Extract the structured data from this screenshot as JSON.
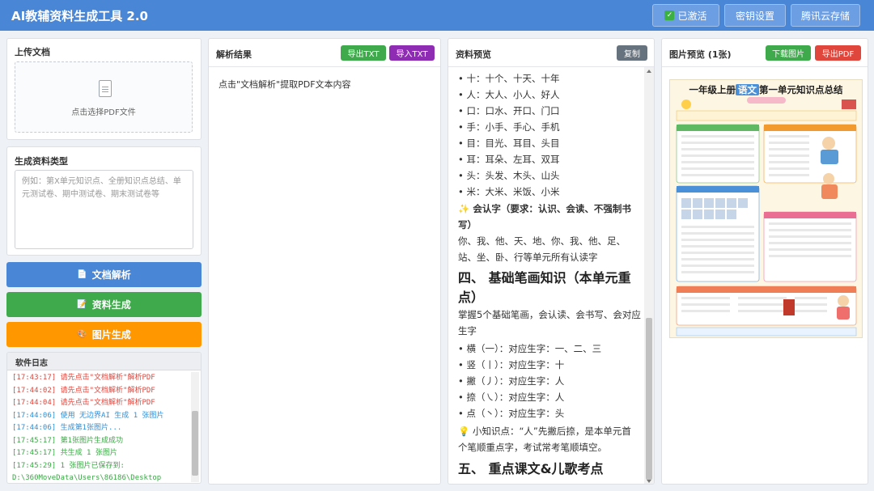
{
  "app": {
    "title": "AI教辅资料生成工具 2.0",
    "buttons": {
      "activated": "已激活",
      "key_settings": "密钥设置",
      "tencent_cloud": "腾讯云存储"
    }
  },
  "left": {
    "upload_title": "上传文档",
    "upload_hint": "点击选择PDF文件",
    "type_title": "生成资料类型",
    "type_placeholder": "例如：第X单元知识点、全册知识点总结、单元测试卷、期中测试卷、期末测试卷等",
    "btn_parse": "文档解析",
    "btn_generate": "资料生成",
    "btn_image": "图片生成",
    "log_title": "软件日志",
    "log": [
      {
        "text": "[17:43:17] 请先点击\"文档解析\"解析PDF",
        "color": "#e0463c"
      },
      {
        "text": "[17:44:02] 请先点击\"文档解析\"解析PDF",
        "color": "#e0463c"
      },
      {
        "text": "[17:44:04] 请先点击\"文档解析\"解析PDF",
        "color": "#e0463c"
      },
      {
        "text": "[17:44:06] 使用 无边界AI 生成 1 张图片",
        "color": "#2f8fd8"
      },
      {
        "text": "[17:44:06] 生成第1张图片...",
        "color": "#2f8fd8"
      },
      {
        "text": "[17:45:17] 第1张图片生成成功",
        "color": "#3aa845"
      },
      {
        "text": "[17:45:17] 共生成 1 张图片",
        "color": "#3aa845"
      },
      {
        "text": "[17:45:29] 1 张图片已保存到: D:\\360MoveData\\Users\\86186\\Desktop",
        "color": "#3aa845"
      }
    ]
  },
  "parse": {
    "title": "解析结果",
    "export_txt": "导出TXT",
    "import_txt": "导入TXT",
    "hint": "点击\"文档解析\"提取PDF文本内容"
  },
  "preview": {
    "title": "资料预览",
    "copy": "复制",
    "lines": [
      {
        "text": "• 十：十个、十天、十年",
        "style": ""
      },
      {
        "text": "• 人：大人、小人、好人",
        "style": ""
      },
      {
        "text": "• 口：口水、开口、门口",
        "style": ""
      },
      {
        "text": "• 手：小手、手心、手机",
        "style": ""
      },
      {
        "text": "• 目：目光、耳目、头目",
        "style": ""
      },
      {
        "text": "• 耳：耳朵、左耳、双耳",
        "style": ""
      },
      {
        "text": "• 头：头发、木头、山头",
        "style": ""
      },
      {
        "text": "• 米：大米、米饭、小米",
        "style": ""
      },
      {
        "text": "✨ 会认字（要求：认识、会读、不强制书",
        "style": "b"
      },
      {
        "text": "写）",
        "style": "b"
      },
      {
        "text": "你、我、他、天、地、你、我、他、足、",
        "style": ""
      },
      {
        "text": "站、坐、卧、行等单元所有认读字",
        "style": ""
      },
      {
        "text": "四、 基础笔画知识（本单元重",
        "style": "h"
      },
      {
        "text": "点）",
        "style": "h"
      },
      {
        "text": "掌握5个基础笔画，会认读、会书写、会对应",
        "style": ""
      },
      {
        "text": "生字",
        "style": ""
      },
      {
        "text": "• 横（一）：对应生字：一、二、三",
        "style": ""
      },
      {
        "text": "• 竖（丨）：对应生字：十",
        "style": ""
      },
      {
        "text": "• 撇（丿）：对应生字：人",
        "style": ""
      },
      {
        "text": "• 捺（㇏）：对应生字：人",
        "style": ""
      },
      {
        "text": "• 点（丶）：对应生字：头",
        "style": ""
      },
      {
        "text": "💡 小知识点：“人”先撇后捺，是本单元首",
        "style": ""
      },
      {
        "text": "个笔顺重点字，考试常考笔顺填空。",
        "style": ""
      },
      {
        "text": "五、 重点课文&儿歌考点",
        "style": "h"
      }
    ]
  },
  "image_preview": {
    "title": "图片预览 (1张)",
    "download": "下载图片",
    "export_pdf": "导出PDF",
    "poster_title_a": "一年级上册",
    "poster_title_b": "语文",
    "poster_title_c": "第一单元知识点总结"
  },
  "colors": {
    "titlebar": "#4a86d6",
    "blue_button": "#4a86d6",
    "green_button": "#3faa4b",
    "orange_button": "#ff9800",
    "purple_button": "#8e2cb4",
    "red_button": "#e0463c",
    "grey_button": "#66727d"
  }
}
